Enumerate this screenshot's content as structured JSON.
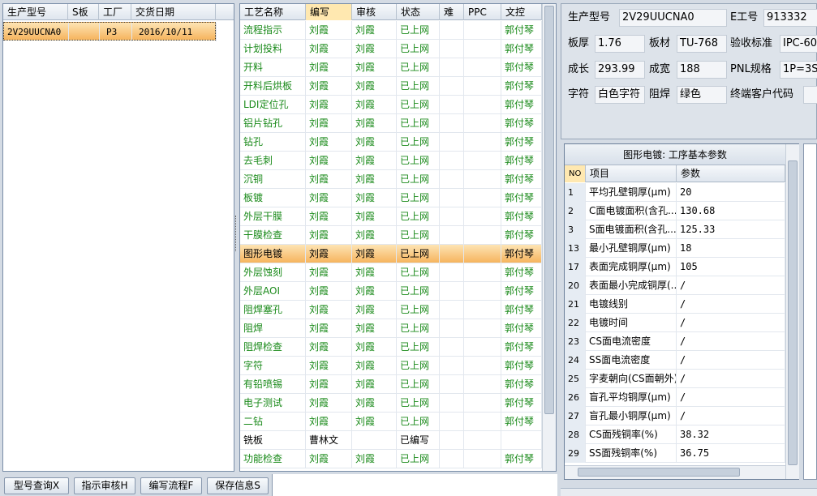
{
  "left": {
    "headers": [
      "生产型号",
      "S板",
      "工厂",
      "交货日期"
    ],
    "rows": [
      [
        "2V29UUCNA0",
        "",
        "P3",
        "2016/10/11"
      ]
    ]
  },
  "mid": {
    "headers": [
      "工艺名称",
      "编写",
      "审核",
      "状态",
      "难",
      "PPC",
      "文控"
    ],
    "rows": [
      [
        "流程指示",
        "刘霞",
        "刘霞",
        "已上网",
        "",
        "",
        "郭付琴"
      ],
      [
        "计划投料",
        "刘霞",
        "刘霞",
        "已上网",
        "",
        "",
        "郭付琴"
      ],
      [
        "开料",
        "刘霞",
        "刘霞",
        "已上网",
        "",
        "",
        "郭付琴"
      ],
      [
        "开料后烘板",
        "刘霞",
        "刘霞",
        "已上网",
        "",
        "",
        "郭付琴"
      ],
      [
        "LDI定位孔",
        "刘霞",
        "刘霞",
        "已上网",
        "",
        "",
        "郭付琴"
      ],
      [
        "铝片钻孔",
        "刘霞",
        "刘霞",
        "已上网",
        "",
        "",
        "郭付琴"
      ],
      [
        "钻孔",
        "刘霞",
        "刘霞",
        "已上网",
        "",
        "",
        "郭付琴"
      ],
      [
        "去毛刺",
        "刘霞",
        "刘霞",
        "已上网",
        "",
        "",
        "郭付琴"
      ],
      [
        "沉铜",
        "刘霞",
        "刘霞",
        "已上网",
        "",
        "",
        "郭付琴"
      ],
      [
        "板镀",
        "刘霞",
        "刘霞",
        "已上网",
        "",
        "",
        "郭付琴"
      ],
      [
        "外层干膜",
        "刘霞",
        "刘霞",
        "已上网",
        "",
        "",
        "郭付琴"
      ],
      [
        "干膜检查",
        "刘霞",
        "刘霞",
        "已上网",
        "",
        "",
        "郭付琴"
      ],
      [
        "图形电镀",
        "刘霞",
        "刘霞",
        "已上网",
        "",
        "",
        "郭付琴"
      ],
      [
        "外层蚀刻",
        "刘霞",
        "刘霞",
        "已上网",
        "",
        "",
        "郭付琴"
      ],
      [
        "外层AOI",
        "刘霞",
        "刘霞",
        "已上网",
        "",
        "",
        "郭付琴"
      ],
      [
        "阻焊塞孔",
        "刘霞",
        "刘霞",
        "已上网",
        "",
        "",
        "郭付琴"
      ],
      [
        "阻焊",
        "刘霞",
        "刘霞",
        "已上网",
        "",
        "",
        "郭付琴"
      ],
      [
        "阻焊检查",
        "刘霞",
        "刘霞",
        "已上网",
        "",
        "",
        "郭付琴"
      ],
      [
        "字符",
        "刘霞",
        "刘霞",
        "已上网",
        "",
        "",
        "郭付琴"
      ],
      [
        "有铅喷锡",
        "刘霞",
        "刘霞",
        "已上网",
        "",
        "",
        "郭付琴"
      ],
      [
        "电子测试",
        "刘霞",
        "刘霞",
        "已上网",
        "",
        "",
        "郭付琴"
      ],
      [
        "二钻",
        "刘霞",
        "刘霞",
        "已上网",
        "",
        "",
        "郭付琴"
      ],
      [
        "铣板",
        "曹林文",
        "",
        "已编写",
        "",
        "",
        ""
      ],
      [
        "功能检查",
        "刘霞",
        "刘霞",
        "已上网",
        "",
        "",
        "郭付琴"
      ]
    ]
  },
  "info": {
    "model_label": "生产型号",
    "model": "2V29UUCNA0",
    "eng_label": "E工号",
    "eng": "913332",
    "thick_label": "板厚",
    "thick": "1.76",
    "mat_label": "板材",
    "mat": "TU-768",
    "std_label": "验收标准",
    "std": "IPC-60",
    "len_label": "成长",
    "len": "293.99",
    "wid_label": "成宽",
    "wid": "188",
    "pnl_label": "PNL规格",
    "pnl": "1P=3S",
    "char_label": "字符",
    "char": "白色字符",
    "mask_label": "阻焊",
    "mask": "绿色",
    "cust_label": "终端客户代码",
    "cust": ""
  },
  "params": {
    "title": "图形电镀: 工序基本参数",
    "headers": [
      "NO",
      "项目",
      "参数"
    ],
    "rows": [
      [
        "1",
        "平均孔壁铜厚(μm)",
        "20"
      ],
      [
        "2",
        "C面电镀面积(含孔...",
        "130.68"
      ],
      [
        "3",
        "S面电镀面积(含孔...",
        "125.33"
      ],
      [
        "13",
        "最小孔壁铜厚(μm)",
        "18"
      ],
      [
        "17",
        "表面完成铜厚(μm)",
        "105"
      ],
      [
        "20",
        "表面最小完成铜厚(...",
        "/"
      ],
      [
        "21",
        "电镀线别",
        "/"
      ],
      [
        "22",
        "电镀时间",
        "/"
      ],
      [
        "23",
        "CS面电流密度",
        "/"
      ],
      [
        "24",
        "SS面电流密度",
        "/"
      ],
      [
        "25",
        "字麦朝向(CS面朝外)",
        "/"
      ],
      [
        "26",
        "盲孔平均铜厚(μm)",
        "/"
      ],
      [
        "27",
        "盲孔最小铜厚(μm)",
        "/"
      ],
      [
        "28",
        "CS面残铜率(%)",
        "38.32"
      ],
      [
        "29",
        "SS面残铜率(%)",
        "36.75"
      ]
    ]
  },
  "buttons": {
    "query": "型号查询X",
    "review": "指示审核H",
    "flow": "编写流程F",
    "save": "保存信息S"
  },
  "colors": {
    "status_green": "#1a8a1a",
    "selection": "#f6b45e"
  }
}
